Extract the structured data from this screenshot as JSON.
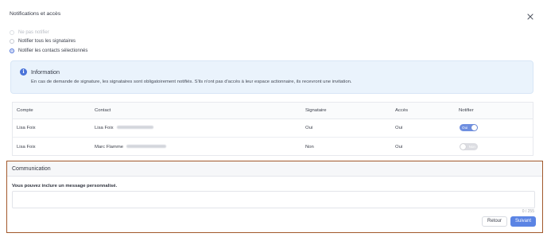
{
  "header": {
    "title": "Notifications et accès"
  },
  "options": [
    {
      "label": "Ne pas notifier",
      "state": "disabled"
    },
    {
      "label": "Notifier tous les signataires",
      "state": "unchecked"
    },
    {
      "label": "Notifier les contacts sélectionnés",
      "state": "checked"
    }
  ],
  "info": {
    "icon": "info-icon",
    "title": "Information",
    "text": "En cas de demande de signature, les signataires sont obligatoirement notifiés. S'ils n'ont pas d'accès à leur espace actionnaire, ils recevront une invitation."
  },
  "table": {
    "headers": [
      "Compte",
      "Contact",
      "Signataire",
      "Accès",
      "Notifier"
    ],
    "rows": [
      {
        "compte": "Lisa Foix",
        "contact": "Lisa Foix",
        "signataire": "Oui",
        "acces": "Oui",
        "notifier": "Oui",
        "notifier_on": true
      },
      {
        "compte": "Lisa Foix",
        "contact": "Marc Flamme",
        "signataire": "Non",
        "acces": "Oui",
        "notifier": "Non",
        "notifier_on": false
      }
    ]
  },
  "communication": {
    "title": "Communication",
    "label": "Vous pouvez inclure un message personnalisé.",
    "message": "",
    "counter": "0 / 255"
  },
  "buttons": {
    "back": "Retour",
    "next": "Suivant"
  },
  "colors": {
    "accent": "#5b84e4",
    "highlight_border": "#a2582b",
    "info_bg": "#eaf3fc"
  }
}
